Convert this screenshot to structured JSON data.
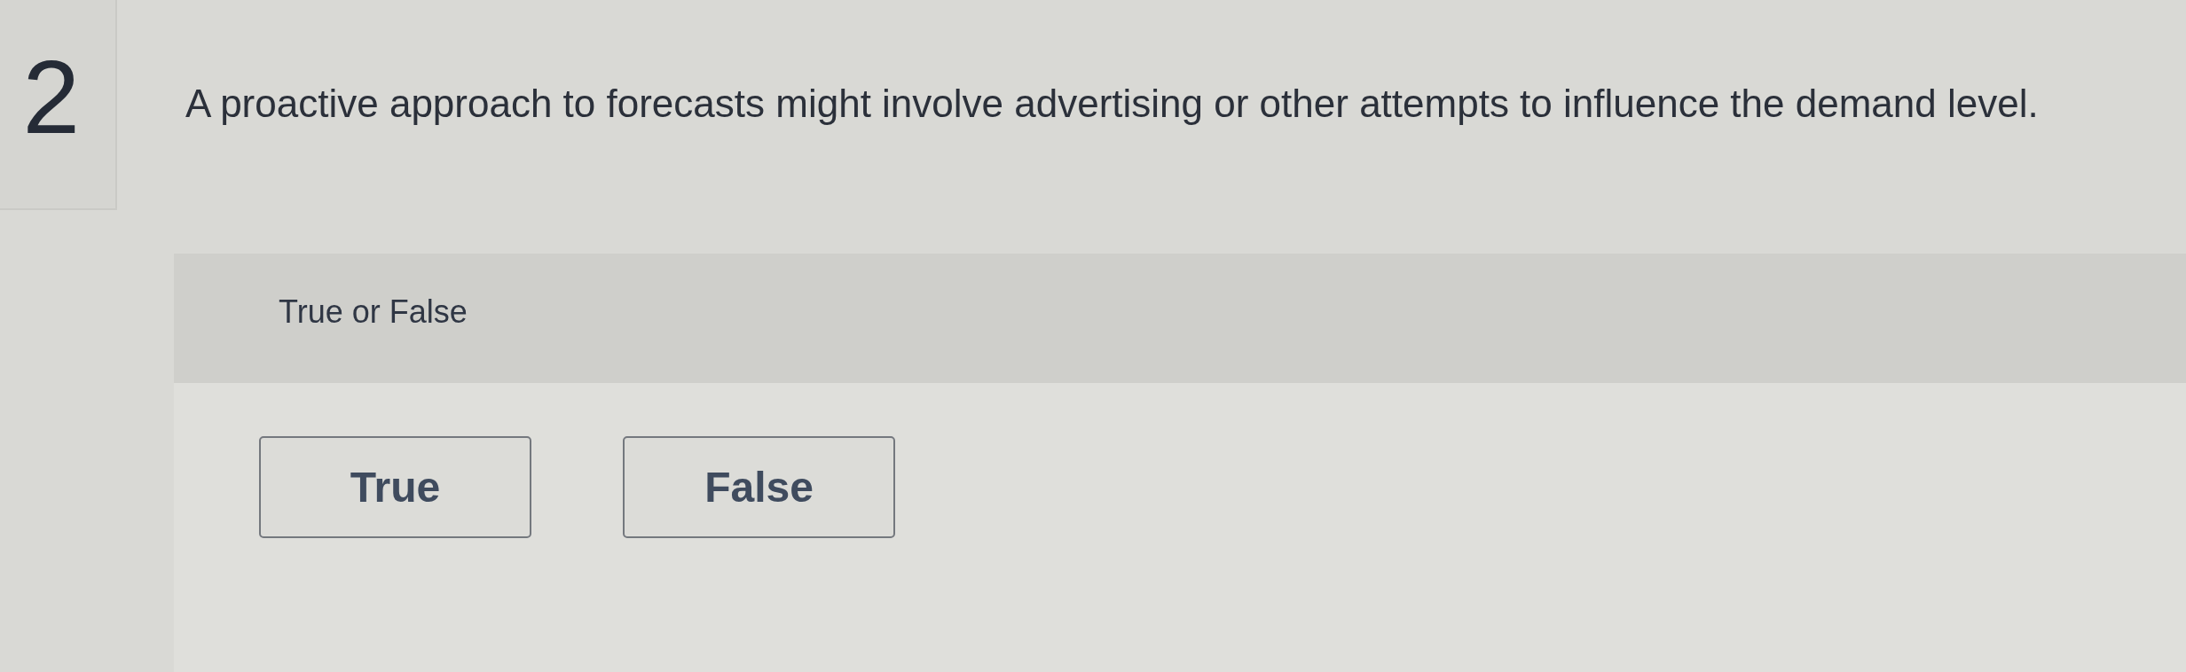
{
  "question_number": "2",
  "question": "A proactive approach to forecasts might involve advertising or other attempts to influence the demand level.",
  "prompt": "True or False",
  "options": [
    {
      "label": "True",
      "selected": false
    },
    {
      "label": "False",
      "selected": false
    }
  ]
}
